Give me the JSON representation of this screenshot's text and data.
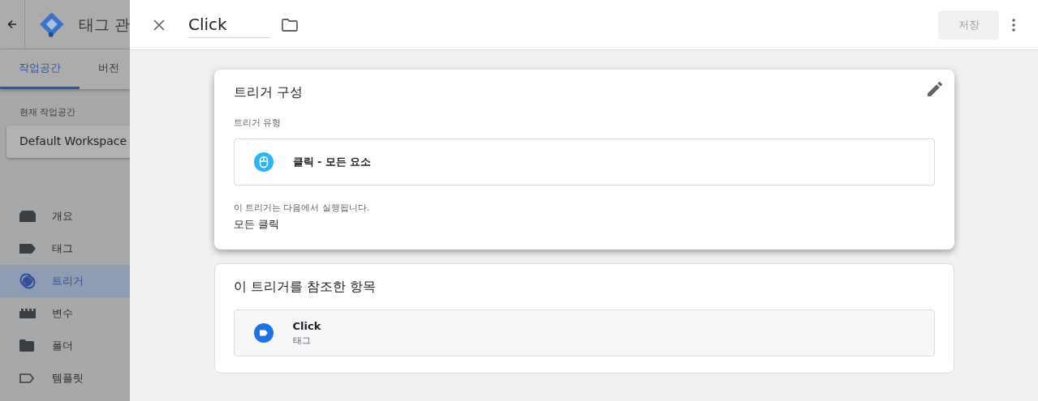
{
  "app": {
    "title": "태그 관",
    "tabs": [
      {
        "label": "작업공간",
        "selected": true
      },
      {
        "label": "버전",
        "selected": false
      }
    ],
    "workspace_label": "현재 작업공간",
    "workspace": "Default Workspace",
    "nav": [
      {
        "kind": "overview",
        "label": "개요",
        "selected": false
      },
      {
        "kind": "tag",
        "label": "태그",
        "selected": false
      },
      {
        "kind": "trigger",
        "label": "트리거",
        "selected": true
      },
      {
        "kind": "variable",
        "label": "변수",
        "selected": false
      },
      {
        "kind": "folder",
        "label": "폴더",
        "selected": false
      },
      {
        "kind": "template",
        "label": "템플릿",
        "selected": false
      }
    ]
  },
  "editor": {
    "name": "Click",
    "save": {
      "label": "저장",
      "disabled": true
    },
    "config": {
      "title": "트리거 구성",
      "type_label": "트리거 유형",
      "type": "클릭 - 모든 요소",
      "fires_label": "이 트리거는 다음에서 실행됩니다.",
      "fires": "모든 클릭"
    },
    "references": {
      "title": "이 트리거를 참조한 항목",
      "items": [
        {
          "name": "Click",
          "type": "태그"
        }
      ]
    }
  }
}
